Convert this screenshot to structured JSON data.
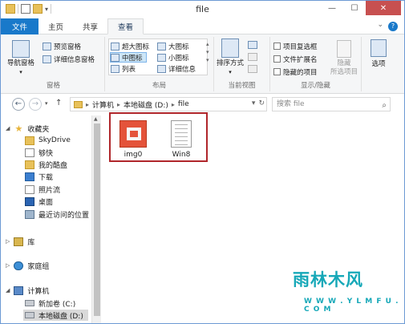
{
  "window": {
    "title": "file",
    "controls": {
      "minimize": "—",
      "maximize": "☐",
      "close": "✕"
    }
  },
  "ribbon_tabs": [
    {
      "label": "文件"
    },
    {
      "label": "主页"
    },
    {
      "label": "共享"
    },
    {
      "label": "查看"
    }
  ],
  "ribbon": {
    "panes": {
      "navigation_pane": "导航窗格",
      "preview_pane": "预览窗格",
      "details_pane": "详细信息窗格",
      "label": "窗格"
    },
    "layout": {
      "extra_large": "超大图标",
      "large": "大图标",
      "medium": "中图标",
      "small": "小图标",
      "list": "列表",
      "details": "详细信息",
      "label": "布局"
    },
    "current_view": {
      "sort": "排序方式",
      "label": "当前视图"
    },
    "show_hide": {
      "item_checkboxes": "项目复选框",
      "file_extensions": "文件扩展名",
      "hidden_items": "隐藏的项目",
      "hide": "隐藏",
      "hide_sub": "所选项目",
      "label": "显示/隐藏"
    },
    "options": "选项"
  },
  "address": {
    "segments": [
      "计算机",
      "本地磁盘 (D:)",
      "file"
    ],
    "search_placeholder": "搜索 file"
  },
  "nav_pane": {
    "favorites": "收藏夹",
    "items": [
      "SkyDrive",
      "够快",
      "我的酷盘",
      "下载",
      "照片流",
      "桌面",
      "最近访问的位置"
    ],
    "libraries": "库",
    "homegroup": "家庭组",
    "computer": "计算机",
    "drives": [
      "新加卷 (C:)",
      "本地磁盘 (D:)"
    ]
  },
  "files": [
    {
      "name": "img0",
      "icon": "image-file-icon"
    },
    {
      "name": "Win8",
      "icon": "text-file-icon"
    }
  ],
  "watermark": {
    "main": "雨林木风",
    "sub": "W W W . Y L M F U . C O M"
  },
  "colors": {
    "file_tab": "#1979ca",
    "close_button": "#c75050",
    "selection_rect": "#b0262b",
    "watermark": "#16a8b8"
  }
}
